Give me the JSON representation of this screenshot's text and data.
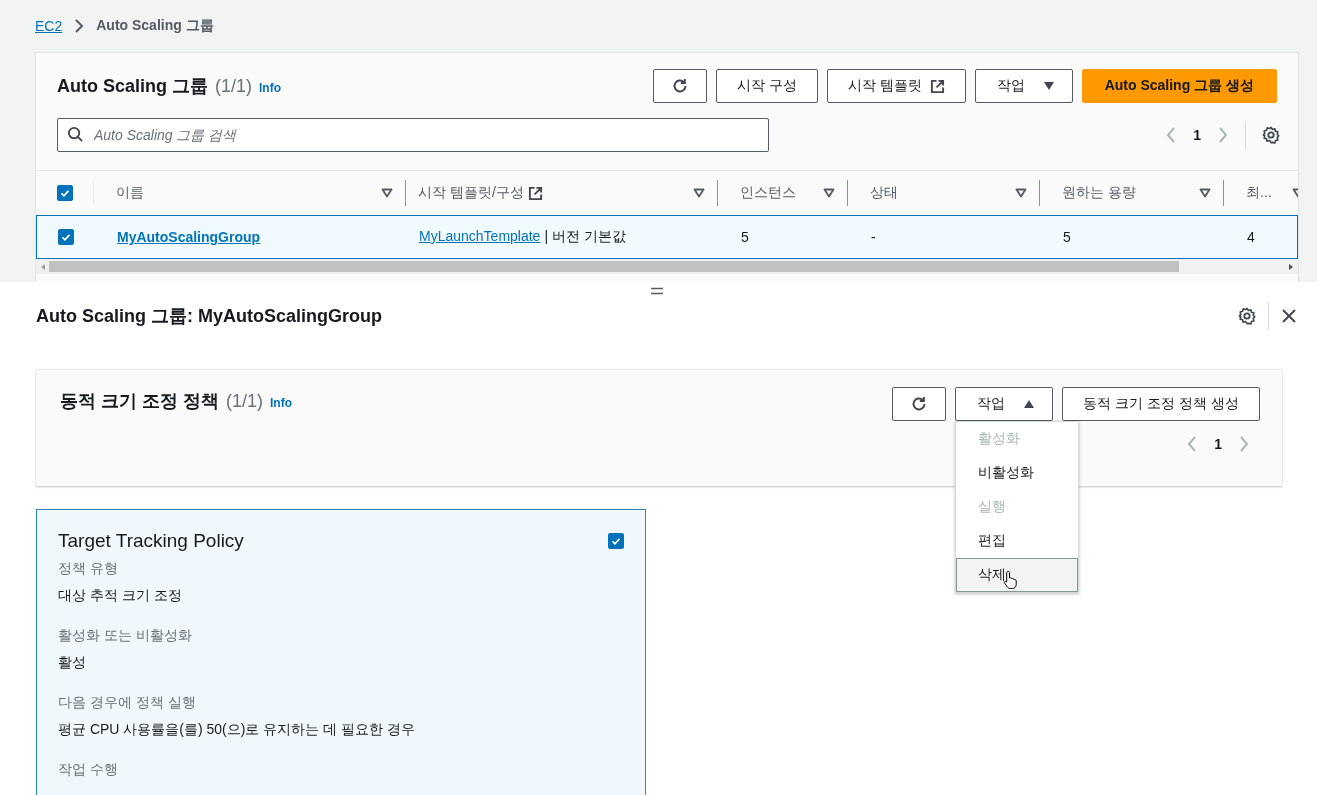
{
  "breadcrumb": [
    {
      "kind": "link",
      "label": "EC2"
    },
    {
      "kind": "current",
      "label": "Auto Scaling 그룹"
    }
  ],
  "groups_panel": {
    "title": "Auto Scaling 그룹",
    "count": "(1/1)",
    "info": "Info",
    "buttons": [
      {
        "kind": "refresh"
      },
      {
        "kind": "plain",
        "label": "시작 구성"
      },
      {
        "kind": "external",
        "label": "시작 템플릿"
      },
      {
        "kind": "dropdown",
        "label": "작업",
        "expanded": false
      },
      {
        "kind": "primary",
        "label": "Auto Scaling 그룹 생성"
      }
    ],
    "search": {
      "placeholder": "Auto Scaling 그룹 검색"
    },
    "page": "1",
    "table": {
      "header_checked": true,
      "columns": [
        {
          "label": "이름",
          "external": false
        },
        {
          "label": "시작 템플릿/구성",
          "external": true
        },
        {
          "label": "인스턴스",
          "external": false
        },
        {
          "label": "상태",
          "external": false
        },
        {
          "label": "원하는 용량",
          "external": false
        },
        {
          "label": "최...",
          "external": false
        }
      ],
      "rows": [
        {
          "checked": true,
          "selected": true,
          "cells": [
            {
              "kind": "link",
              "text": "MyAutoScalingGroup"
            },
            {
              "kind": "link_text",
              "link": "MyLaunchTemplate",
              "text": "| 버전 기본값"
            },
            {
              "kind": "text",
              "text": "5"
            },
            {
              "kind": "text",
              "text": "-"
            },
            {
              "kind": "text",
              "text": "5"
            },
            {
              "kind": "text",
              "text": "4"
            }
          ]
        }
      ]
    }
  },
  "detail": {
    "title": "Auto Scaling 그룹: MyAutoScalingGroup",
    "policies_panel": {
      "title": "동적 크기 조정 정책",
      "count": "(1/1)",
      "info": "Info",
      "buttons": [
        {
          "kind": "refresh"
        },
        {
          "kind": "dropdown",
          "label": "작업",
          "expanded": true,
          "menu": [
            {
              "label": "활성화",
              "disabled": true,
              "highlighted": false
            },
            {
              "label": "비활성화",
              "disabled": false,
              "highlighted": false
            },
            {
              "label": "실행",
              "disabled": true,
              "highlighted": false
            },
            {
              "label": "편집",
              "disabled": false,
              "highlighted": false
            },
            {
              "label": "삭제",
              "disabled": false,
              "highlighted": true
            }
          ]
        },
        {
          "kind": "plain",
          "label": "동적 크기 조정 정책 생성"
        }
      ],
      "page": "1"
    },
    "policy_card": {
      "title": "Target Tracking Policy",
      "checked": true,
      "selected": true,
      "fields": [
        {
          "label": "정책 유형",
          "value": "대상 추적 크기 조정"
        },
        {
          "label": "활성화 또는 비활성화",
          "value": "활성"
        },
        {
          "label": "다음 경우에 정책 실행",
          "value": "평균 CPU 사용률을(를) 50(으)로 유지하는 데 필요한 경우"
        },
        {
          "label": "작업 수행"
        }
      ]
    }
  }
}
